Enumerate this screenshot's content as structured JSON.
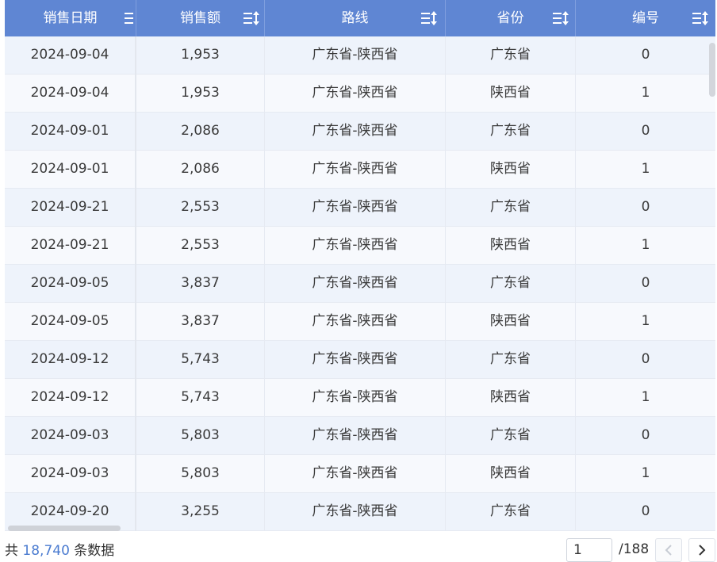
{
  "table": {
    "columns": [
      {
        "label": "销售日期",
        "icon": "sort-filter-icon"
      },
      {
        "label": "销售额",
        "icon": "sort-filter-icon"
      },
      {
        "label": "路线",
        "icon": "sort-filter-icon"
      },
      {
        "label": "省份",
        "icon": "sort-filter-icon"
      },
      {
        "label": "编号",
        "icon": "sort-filter-icon"
      }
    ],
    "rows": [
      [
        "2024-09-04",
        "1,953",
        "广东省-陕西省",
        "广东省",
        "0"
      ],
      [
        "2024-09-04",
        "1,953",
        "广东省-陕西省",
        "陕西省",
        "1"
      ],
      [
        "2024-09-01",
        "2,086",
        "广东省-陕西省",
        "广东省",
        "0"
      ],
      [
        "2024-09-01",
        "2,086",
        "广东省-陕西省",
        "陕西省",
        "1"
      ],
      [
        "2024-09-21",
        "2,553",
        "广东省-陕西省",
        "广东省",
        "0"
      ],
      [
        "2024-09-21",
        "2,553",
        "广东省-陕西省",
        "陕西省",
        "1"
      ],
      [
        "2024-09-05",
        "3,837",
        "广东省-陕西省",
        "广东省",
        "0"
      ],
      [
        "2024-09-05",
        "3,837",
        "广东省-陕西省",
        "陕西省",
        "1"
      ],
      [
        "2024-09-12",
        "5,743",
        "广东省-陕西省",
        "广东省",
        "0"
      ],
      [
        "2024-09-12",
        "5,743",
        "广东省-陕西省",
        "陕西省",
        "1"
      ],
      [
        "2024-09-03",
        "5,803",
        "广东省-陕西省",
        "广东省",
        "0"
      ],
      [
        "2024-09-03",
        "5,803",
        "广东省-陕西省",
        "陕西省",
        "1"
      ],
      [
        "2024-09-20",
        "3,255",
        "广东省-陕西省",
        "广东省",
        "0"
      ]
    ]
  },
  "footer": {
    "total_prefix": "共",
    "total_count": "18,740",
    "total_suffix": "条数据",
    "current_page": "1",
    "page_total": "/188"
  },
  "colors": {
    "header_bg": "#5f86d3",
    "accent": "#4a7bd0",
    "row_odd": "#eef3fb",
    "row_even": "#f7f9fd"
  },
  "icons": {
    "prev": "chevron-left-icon",
    "next": "chevron-right-icon"
  }
}
